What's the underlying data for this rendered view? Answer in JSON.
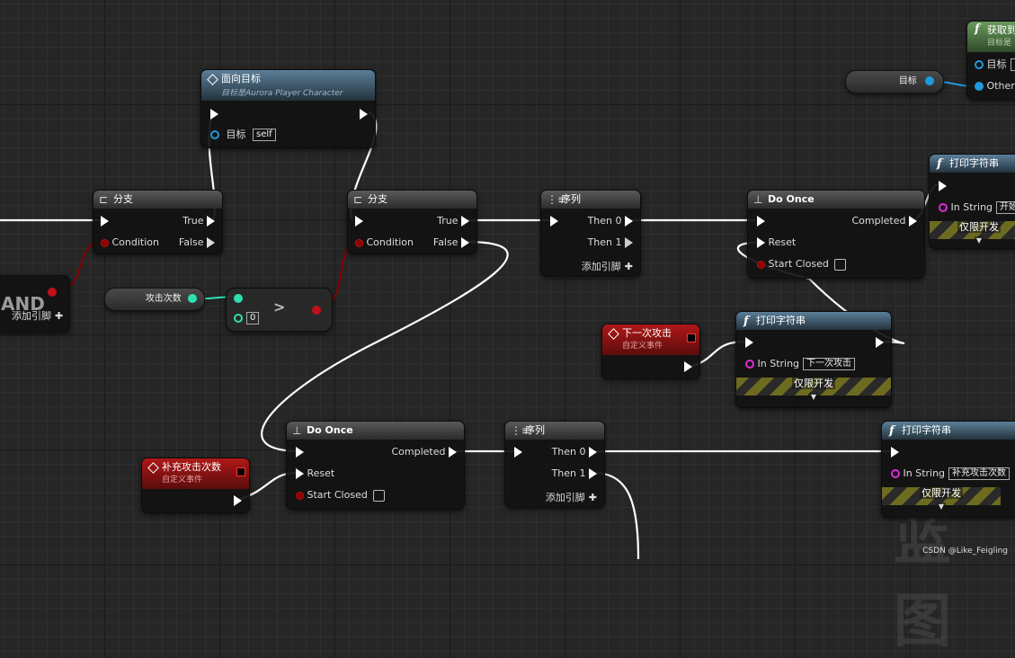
{
  "colors": {
    "exec_wire": "#ffffff",
    "bool_wire": "#8b0000",
    "int_wire": "#2fe0b0",
    "object_wire": "#1e9be0",
    "event_header": "#b01818",
    "function_header": "#5b7f99"
  },
  "and_node": {
    "title": "AND",
    "add_pin": "添加引脚"
  },
  "face_target": {
    "title": "面向目标",
    "subtitle": "目标是Aurora Player Character",
    "target_label": "目标",
    "target_value": "self"
  },
  "branch1": {
    "title": "分支",
    "true_label": "True",
    "condition_label": "Condition",
    "false_label": "False"
  },
  "branch2": {
    "title": "分支",
    "true_label": "True",
    "condition_label": "Condition",
    "false_label": "False"
  },
  "attack_count_var": {
    "label": "攻击次数"
  },
  "greater": {
    "op": ">",
    "value": "0"
  },
  "sequence1": {
    "title": "序列",
    "then0": "Then 0",
    "then1": "Then 1",
    "add_pin": "添加引脚"
  },
  "sequence2": {
    "title": "序列",
    "then0": "Then 0",
    "then1": "Then 1",
    "add_pin": "添加引脚"
  },
  "do_once1": {
    "title": "Do Once",
    "completed": "Completed",
    "reset": "Reset",
    "start_closed": "Start Closed"
  },
  "do_once2": {
    "title": "Do Once",
    "completed": "Completed",
    "reset": "Reset",
    "start_closed": "Start Closed"
  },
  "print1": {
    "title": "打印字符串",
    "in_string_label": "In String",
    "in_string_value": "开始",
    "dev_only": "仅限开发"
  },
  "print2": {
    "title": "打印字符串",
    "in_string_label": "In String",
    "in_string_value": "下一次攻击",
    "dev_only": "仅限开发"
  },
  "print3": {
    "title": "打印字符串",
    "in_string_label": "In String",
    "in_string_value": "补充攻击次数",
    "dev_only": "仅限开发"
  },
  "event_next_attack": {
    "title": "下一次攻击",
    "subtitle": "自定义事件"
  },
  "event_refill": {
    "title": "补充攻击次数",
    "subtitle": "自定义事件"
  },
  "get_node": {
    "title": "获取到",
    "subtitle": "目标是",
    "target_label": "目标",
    "other_label": "Other"
  },
  "target_var": {
    "label": "目标"
  },
  "watermark": "CSDN @Like_Feigling",
  "watermark_big": "蓝图"
}
